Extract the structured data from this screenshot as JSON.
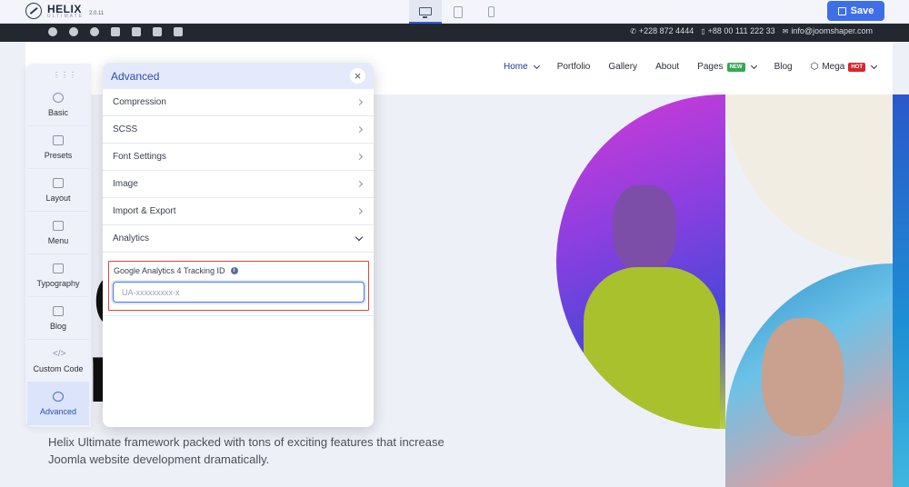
{
  "app": {
    "name": "HELIX",
    "sub": "ULTIMATE",
    "version": "2.0.11"
  },
  "toolbar": {
    "save_label": "Save"
  },
  "infobar": {
    "phone1": "+228 872 4444",
    "phone2": "+88 00 111 222 33",
    "email": "info@joomshaper.com"
  },
  "nav": [
    {
      "label": "Home"
    },
    {
      "label": "Portfolio"
    },
    {
      "label": "Gallery"
    },
    {
      "label": "About"
    },
    {
      "label": "Pages",
      "badge": "NEW"
    },
    {
      "label": "Blog"
    },
    {
      "label": "Mega",
      "badge": "HOT"
    }
  ],
  "sidebar": {
    "items": [
      {
        "label": "Basic"
      },
      {
        "label": "Presets"
      },
      {
        "label": "Layout"
      },
      {
        "label": "Menu"
      },
      {
        "label": "Typography"
      },
      {
        "label": "Blog"
      },
      {
        "label": "Custom Code"
      },
      {
        "label": "Advanced"
      }
    ]
  },
  "panel": {
    "title": "Advanced",
    "sections": [
      {
        "label": "Compression"
      },
      {
        "label": "SCSS"
      },
      {
        "label": "Font Settings"
      },
      {
        "label": "Image"
      },
      {
        "label": "Import & Export"
      },
      {
        "label": "Analytics"
      }
    ],
    "ga_label": "Google Analytics 4 Tracking ID",
    "ga_placeholder": "UA-xxxxxxxxx-x"
  },
  "hero": {
    "big1": "C",
    "big2": "r     k",
    "desc": "Helix Ultimate framework packed with tons of exciting features that increase Joomla website development dramatically."
  }
}
